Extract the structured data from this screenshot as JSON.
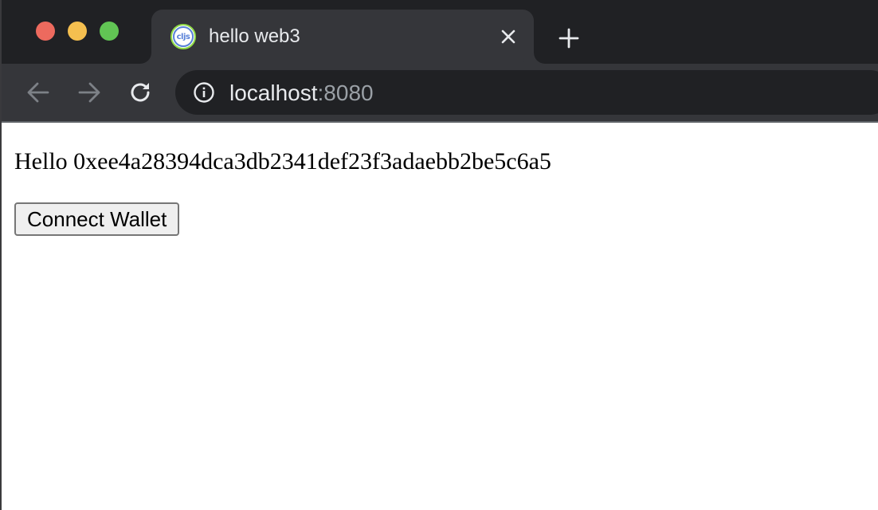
{
  "window_controls": {
    "close": "window-close",
    "minimize": "window-minimize",
    "maximize": "window-maximize"
  },
  "tab": {
    "favicon_text": "cljs",
    "title": "hello web3"
  },
  "address_bar": {
    "host": "localhost",
    "port": ":8080"
  },
  "page": {
    "greeting": "Hello 0xee4a28394dca3db2341def23f3adaebb2be5c6a5",
    "connect_button_label": "Connect Wallet"
  },
  "colors": {
    "chrome_dark": "#202124",
    "chrome_tab": "#35363a",
    "traffic_close": "#ed6a5e",
    "traffic_minimize": "#f5bf4f",
    "traffic_maximize": "#61c554"
  },
  "icons": [
    "info-icon",
    "back-arrow-icon",
    "forward-arrow-icon",
    "reload-icon",
    "close-icon",
    "plus-icon"
  ]
}
